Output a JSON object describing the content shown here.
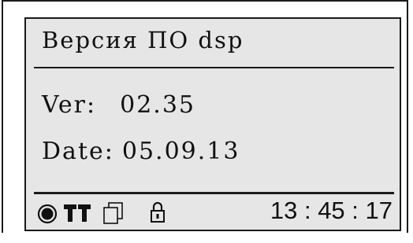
{
  "screen": {
    "title": "Версия ПО dsp",
    "version_label": "Ver:",
    "version_value": "02.35",
    "date_label": "Date:",
    "date_value": "05.09.13"
  },
  "status_bar": {
    "icons": [
      "record-icon",
      "signal-icon",
      "signal-icon",
      "copy-icon",
      "lock-icon"
    ],
    "time": "13 : 45 : 17"
  },
  "colors": {
    "lcd_background": "#e6e6e6",
    "foreground": "#111111"
  }
}
